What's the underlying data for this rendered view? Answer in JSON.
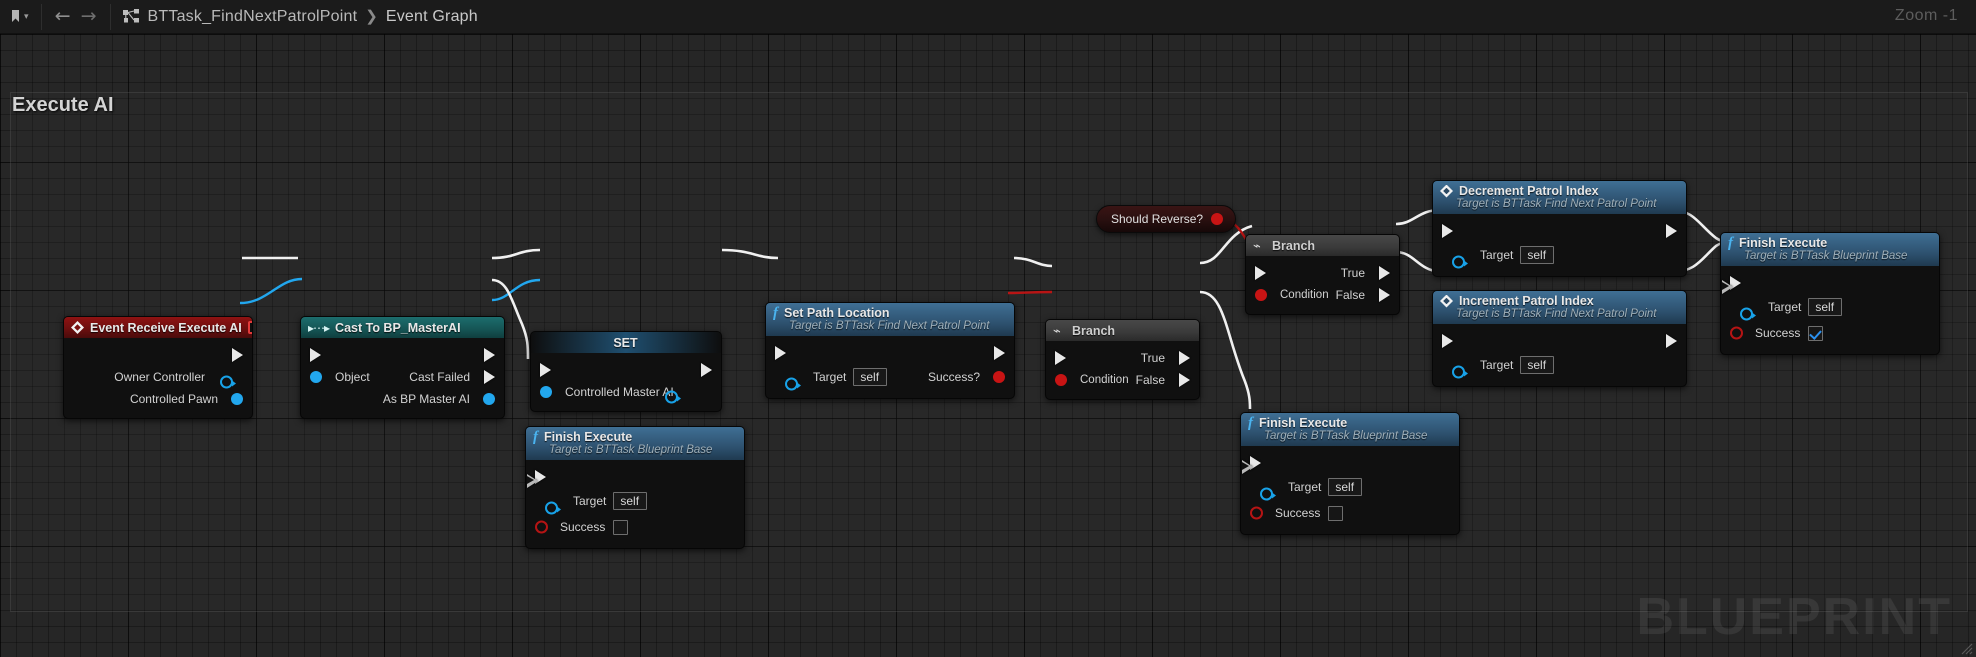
{
  "toolbar": {
    "bookmark_icon": "bookmark-icon",
    "bookmark_caret": "▾",
    "back_icon": "←",
    "forward_icon": "→",
    "graph_icon": "graph-hierarchy-icon",
    "breadcrumb": [
      "BTTask_FindNextPatrolPoint",
      "Event Graph"
    ],
    "breadcrumb_sep": "❯",
    "zoom_label": "Zoom -1"
  },
  "comment": {
    "title": "Execute AI"
  },
  "watermark": "BLUEPRINT",
  "nodes": {
    "event_receive": {
      "title": "Event Receive Execute AI",
      "exec_out": "",
      "pins": [
        {
          "label": "Owner Controller"
        },
        {
          "label": "Controlled Pawn"
        }
      ]
    },
    "cast": {
      "title": "Cast To BP_MasterAI",
      "in_object": "Object",
      "out_cast_failed": "Cast Failed",
      "out_as_bp": "As BP Master AI"
    },
    "set_node": {
      "title": "SET",
      "pin_label": "Controlled Master AI"
    },
    "finish_left": {
      "title": "Finish Execute",
      "subtitle": "Target is BTTask Blueprint Base",
      "target_label": "Target",
      "target_value": "self",
      "success_label": "Success",
      "success_checked": false
    },
    "set_path_location": {
      "title": "Set Path Location",
      "subtitle": "Target is BTTask Find Next Patrol Point",
      "target_label": "Target",
      "target_value": "self",
      "success_label": "Success?"
    },
    "branch_lower": {
      "title": "Branch",
      "condition_label": "Condition",
      "true_label": "True",
      "false_label": "False"
    },
    "should_reverse": {
      "label": "Should Reverse?"
    },
    "branch_upper": {
      "title": "Branch",
      "condition_label": "Condition",
      "true_label": "True",
      "false_label": "False"
    },
    "decrement": {
      "title": "Decrement Patrol Index",
      "subtitle": "Target is BTTask Find Next Patrol Point",
      "target_label": "Target",
      "target_value": "self"
    },
    "increment": {
      "title": "Increment Patrol Index",
      "subtitle": "Target is BTTask Find Next Patrol Point",
      "target_label": "Target",
      "target_value": "self"
    },
    "finish_mid": {
      "title": "Finish Execute",
      "subtitle": "Target is BTTask Blueprint Base",
      "target_label": "Target",
      "target_value": "self",
      "success_label": "Success",
      "success_checked": false
    },
    "finish_right": {
      "title": "Finish Execute",
      "subtitle": "Target is BTTask Blueprint Base",
      "target_label": "Target",
      "target_value": "self",
      "success_label": "Success",
      "success_checked": true
    }
  },
  "colors": {
    "exec_wire": "#f0f0f0",
    "object_wire": "#22a7ee",
    "bool_wire": "#b81414",
    "event_header": "#8f1212",
    "cast_header": "#1c6d6d",
    "function_header": "#3f6f94",
    "canvas_bg": "#262626"
  }
}
